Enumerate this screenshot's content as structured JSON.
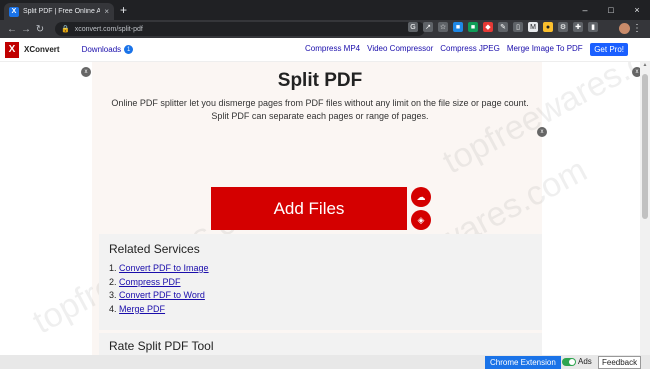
{
  "browser": {
    "tab_title": "Split PDF | Free Online Adobe PDF",
    "tab_close": "×",
    "new_tab": "+",
    "url": "xconvert.com/split-pdf",
    "window_controls": {
      "minimize": "–",
      "maximize": "□",
      "close": "×"
    },
    "menu": "⋮"
  },
  "site": {
    "logo_letter": "X",
    "brand": "XConvert",
    "downloads_label": "Downloads",
    "downloads_count": "1",
    "nav_links": [
      "Compress MP4",
      "Video Compressor",
      "Compress JPEG",
      "Merge Image To PDF"
    ],
    "get_pro": "Get Pro!"
  },
  "main": {
    "title": "Split PDF",
    "desc_line1": "Online PDF splitter let you dismerge pages from PDF files without any limit on the file size or page count.",
    "desc_line2": "Split PDF can separate each pages or range of pages.",
    "add_files": "Add Files",
    "close_x": "x",
    "related": {
      "heading": "Related Services",
      "items": [
        {
          "num": "1.",
          "label": "Convert PDF to Image"
        },
        {
          "num": "2.",
          "label": "Compress PDF"
        },
        {
          "num": "3.",
          "label": "Convert PDF to Word"
        },
        {
          "num": "4.",
          "label": "Merge PDF"
        }
      ]
    },
    "rate_heading": "Rate Split PDF Tool"
  },
  "bottom": {
    "chrome_extension": "Chrome Extension",
    "ads": "Ads",
    "feedback": "Feedback"
  },
  "watermark": "topfreewares.com",
  "colors": {
    "accent_red": "#d40000",
    "link_blue": "#1a0dab",
    "pro_blue": "#1a5fff"
  }
}
